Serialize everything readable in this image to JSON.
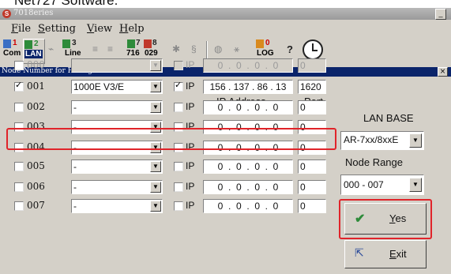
{
  "doc_header": "Net727 Software.",
  "window": {
    "title": "7018eries",
    "minimize": "_"
  },
  "menu": [
    "File",
    "Setting",
    "View",
    "Help"
  ],
  "toolbar": {
    "com": {
      "count": "1",
      "label": "Com"
    },
    "lan": {
      "count": "2",
      "label": "LAN"
    },
    "line": {
      "count": "3",
      "label": "Line"
    },
    "counter": {
      "count_a": "7",
      "count_b": "8",
      "label_a": "716",
      "label_b": "029"
    },
    "log": {
      "count": "0",
      "label": "LOG"
    },
    "help_symbol": "?"
  },
  "dialog": {
    "title": "Node Number for Polling",
    "close": "×",
    "headers": {
      "ip": "IP Address",
      "port": "Port"
    },
    "rows": [
      {
        "node": "000",
        "checked": false,
        "enabled": false,
        "model": "",
        "ip_checked": false,
        "ip_label": "IP",
        "ip": "0  .  0  .  0  .  0",
        "port": "0"
      },
      {
        "node": "001",
        "checked": true,
        "enabled": true,
        "model": "1000E V3/E",
        "ip_checked": true,
        "ip_label": "IP",
        "ip": "156 . 137 . 86 . 13",
        "port": "1620"
      },
      {
        "node": "002",
        "checked": false,
        "enabled": true,
        "model": "-",
        "ip_checked": false,
        "ip_label": "IP",
        "ip": "0  .  0  .  0  .  0",
        "port": "0"
      },
      {
        "node": "003",
        "checked": false,
        "enabled": true,
        "model": "-",
        "ip_checked": false,
        "ip_label": "IP",
        "ip": "0  .  0  .  0  .  0",
        "port": "0"
      },
      {
        "node": "004",
        "checked": false,
        "enabled": true,
        "model": "-",
        "ip_checked": false,
        "ip_label": "IP",
        "ip": "0  .  0  .  0  .  0",
        "port": "0"
      },
      {
        "node": "005",
        "checked": false,
        "enabled": true,
        "model": "-",
        "ip_checked": false,
        "ip_label": "IP",
        "ip": "0  .  0  .  0  .  0",
        "port": "0"
      },
      {
        "node": "006",
        "checked": false,
        "enabled": true,
        "model": "-",
        "ip_checked": false,
        "ip_label": "IP",
        "ip": "0  .  0  .  0  .  0",
        "port": "0"
      },
      {
        "node": "007",
        "checked": false,
        "enabled": true,
        "model": "-",
        "ip_checked": false,
        "ip_label": "IP",
        "ip": "0  .  0  .  0  .  0",
        "port": "0"
      }
    ],
    "lan_base": {
      "label": "LAN BASE",
      "value": "AR-7xx/8xxE"
    },
    "node_range": {
      "label": "Node Range",
      "value": "000 - 007"
    },
    "yes_button": "Yes",
    "exit_button": "Exit"
  },
  "colors": {
    "highlight": "#e0242a",
    "dialog_title_bg": "#0a246a",
    "face": "#d4d0c8"
  }
}
